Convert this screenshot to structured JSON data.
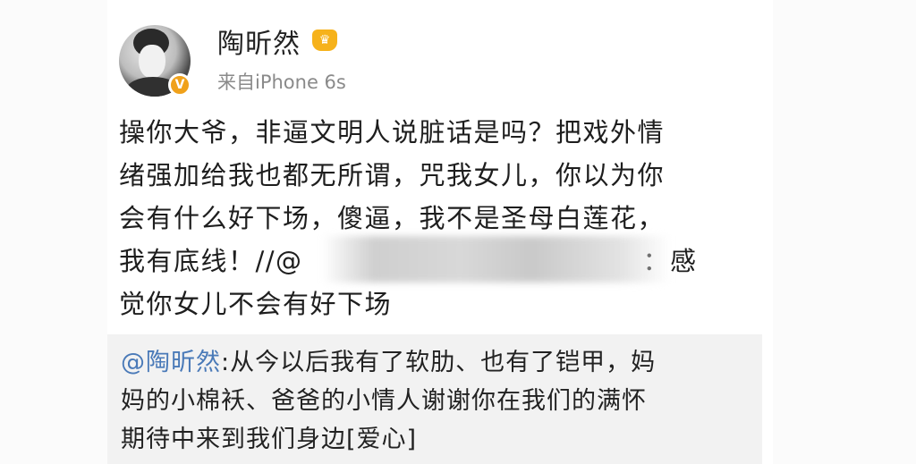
{
  "author": {
    "name": "陶昕然",
    "source": "来自iPhone 6s",
    "vip_icon": "crown-vip-icon",
    "verified_icon": "verified-v-icon",
    "verified_label": "V"
  },
  "post": {
    "lines": [
      "操你大爷，非逼文明人说脏话是吗？把戏外情",
      "绪强加给我也都无所谓，咒我女儿，你以为你",
      "会有什么好下场，傻逼，我不是圣母白莲花，",
      "我有底线！//@",
      "觉你女儿不会有好下场"
    ],
    "line4_tail": "：感"
  },
  "repost": {
    "mention": "@陶昕然",
    "text_line1": ":从今以后我有了软肋、也有了铠甲，妈",
    "text_line2": "妈的小棉袄、爸爸的小情人谢谢你在我们的满怀",
    "text_line3": "期待中来到我们身边[爱心]"
  }
}
